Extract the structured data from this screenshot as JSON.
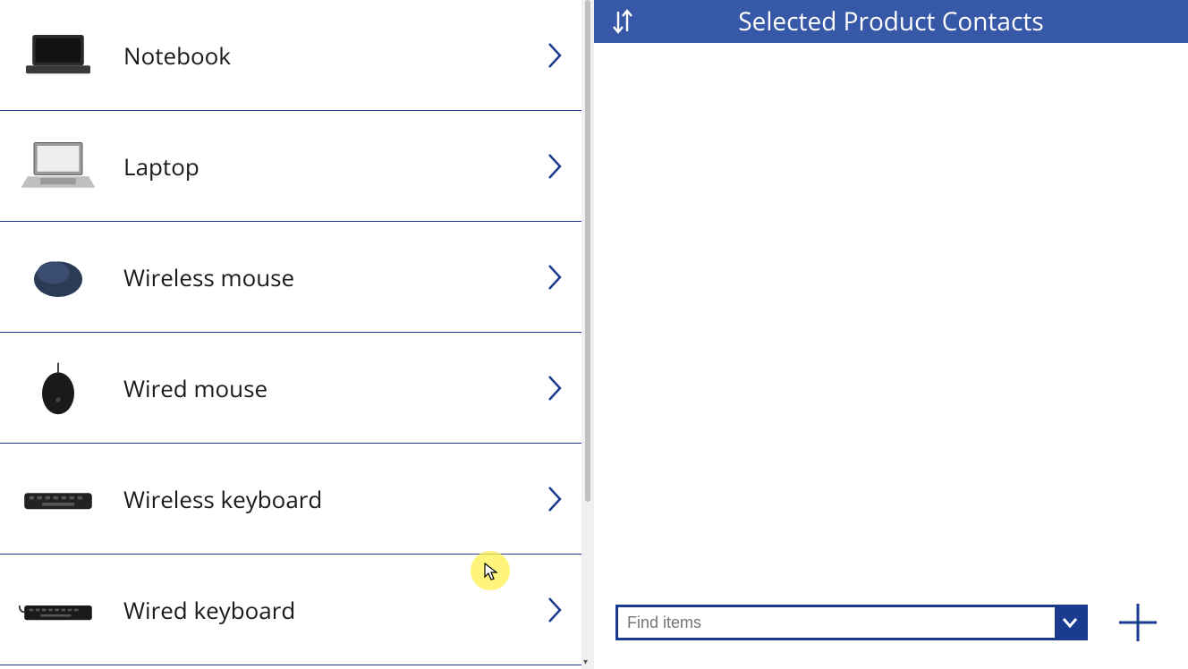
{
  "products": [
    {
      "label": "Notebook",
      "icon": "laptop-closed"
    },
    {
      "label": "Laptop",
      "icon": "laptop-open"
    },
    {
      "label": "Wireless mouse",
      "icon": "mouse-round"
    },
    {
      "label": "Wired mouse",
      "icon": "mouse-wired"
    },
    {
      "label": "Wireless keyboard",
      "icon": "keyboard"
    },
    {
      "label": "Wired keyboard",
      "icon": "keyboard-wired"
    }
  ],
  "rightPanel": {
    "title": "Selected Product Contacts",
    "findPlaceholder": "Find items"
  },
  "colors": {
    "accent": "#1a3b8f",
    "headerBg": "#3658a6"
  }
}
